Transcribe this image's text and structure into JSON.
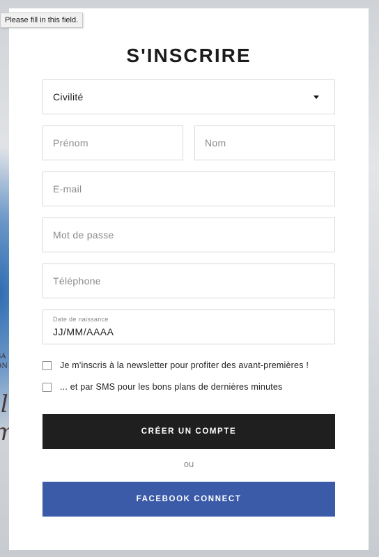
{
  "tooltip": "Please fill in this field.",
  "title": "S'INSCRIRE",
  "civility": {
    "value": "Civilité"
  },
  "fields": {
    "first_name": "Prénom",
    "last_name": "Nom",
    "email": "E-mail",
    "password": "Mot de passe",
    "phone": "Téléphone"
  },
  "birthdate": {
    "label": "Date de naissance",
    "value": "JJ/MM/AAAA"
  },
  "checkboxes": [
    {
      "label": "Je m'inscris à la newsletter pour profiter des avant-premières !",
      "checked": false
    },
    {
      "label": "... et par SMS pour les bons plans de dernières minutes",
      "checked": false
    }
  ],
  "buttons": {
    "create": "CRÉER UN COMPTE",
    "facebook": "FACEBOOK CONNECT"
  },
  "or_text": "ou",
  "colors": {
    "primary_button": "#1f1f1f",
    "facebook_button": "#3b5ba9"
  }
}
